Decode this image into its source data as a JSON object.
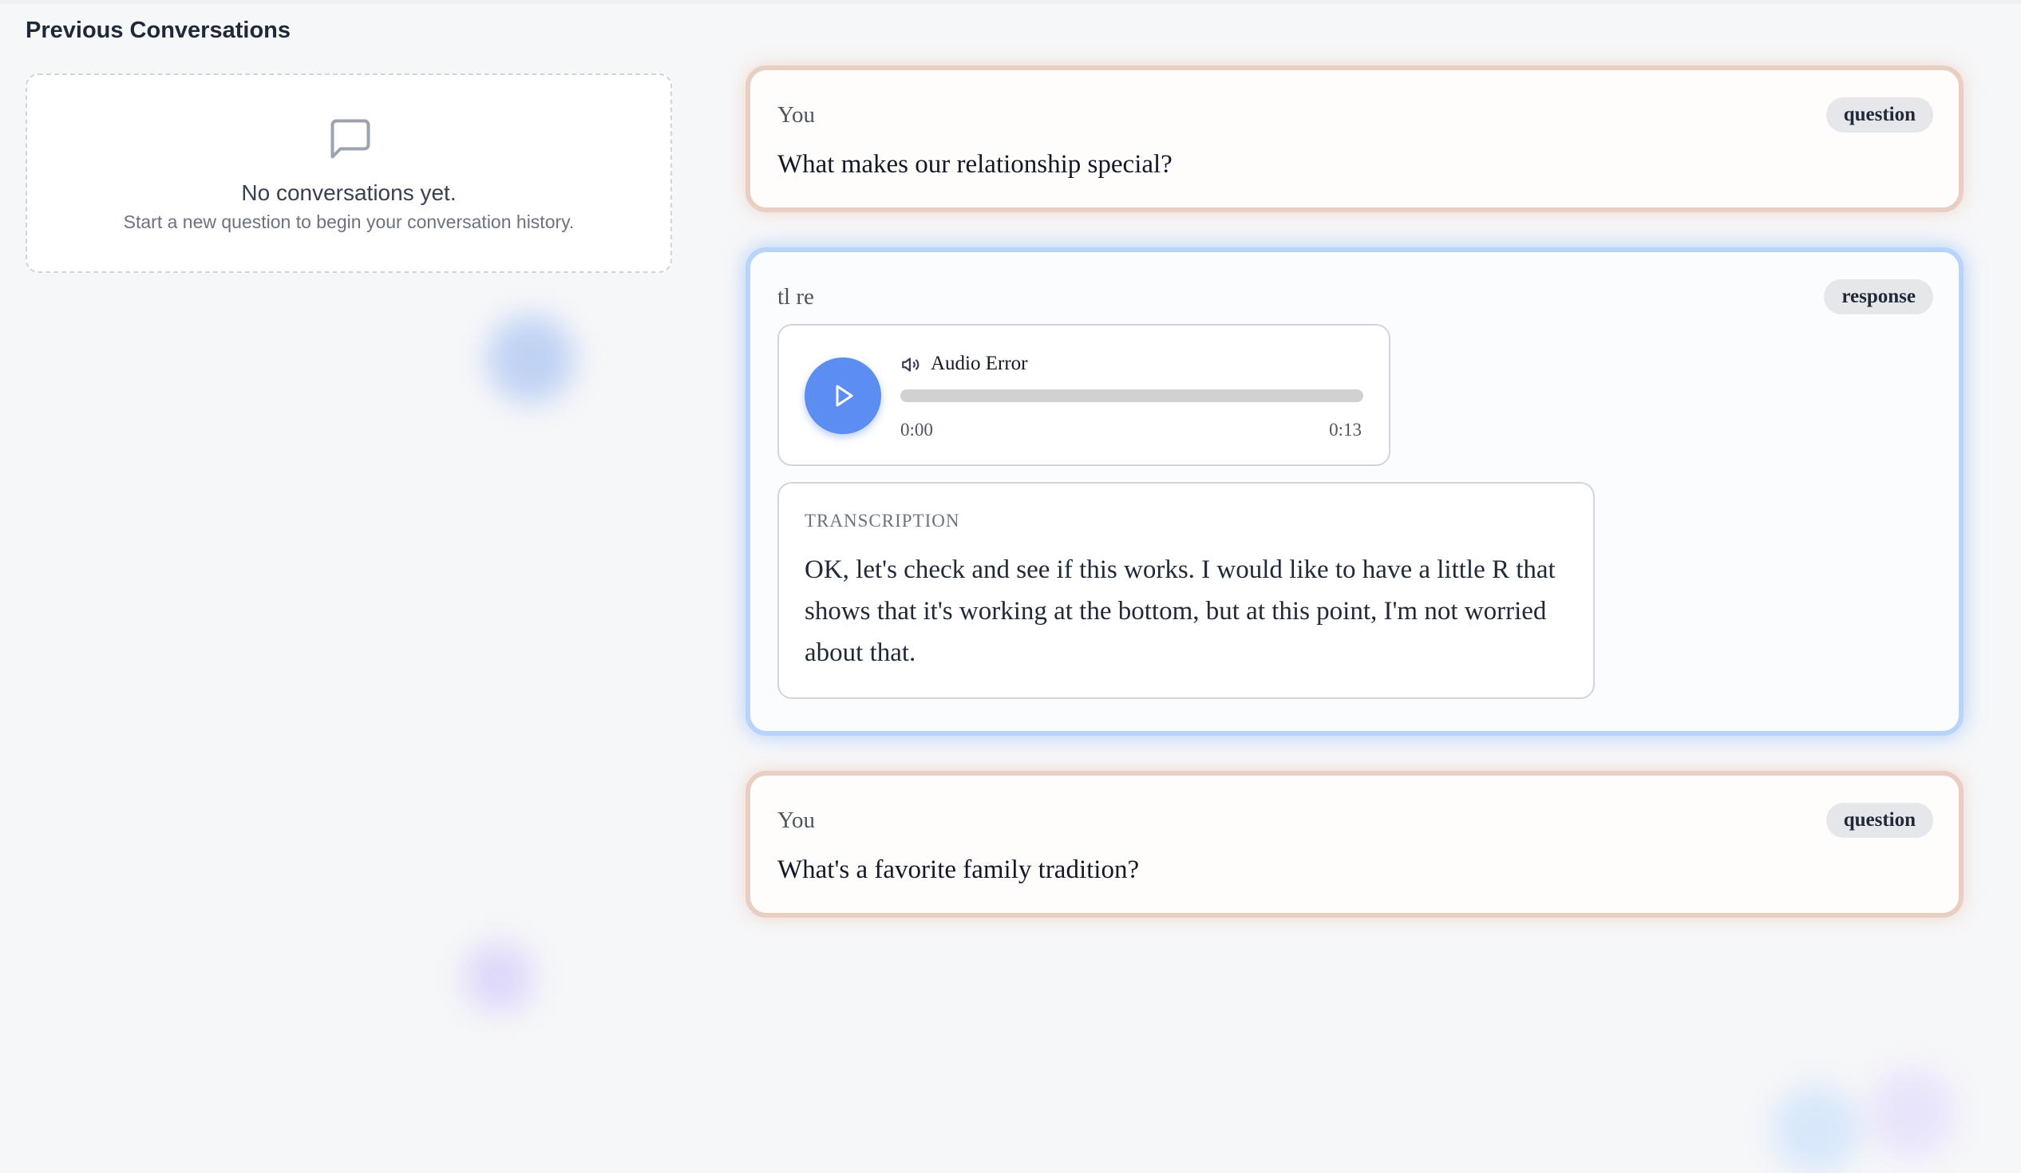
{
  "sidebar": {
    "title": "Previous Conversations",
    "empty_state": {
      "icon": "message-square-icon",
      "title": "No conversations yet.",
      "subtitle": "Start a new question to begin your conversation history."
    }
  },
  "messages": [
    {
      "who": "You",
      "badge": "question",
      "text": "What makes our relationship special?"
    },
    {
      "who": "tl re",
      "badge": "response",
      "audio": {
        "status": "Audio Error",
        "current_time": "0:00",
        "duration": "0:13",
        "progress": 0
      },
      "transcription": {
        "label": "TRANSCRIPTION",
        "text": "OK, let's check and see if this works. I would like to have a little R that shows that it's working at the bottom, but at this point, I'm not worried about that."
      }
    },
    {
      "who": "You",
      "badge": "question",
      "text": "What's a favorite family tradition?"
    }
  ],
  "colors": {
    "question_border": "#e9cfc3",
    "response_border": "#b9d4fb",
    "play_button": "#5b8ef0"
  }
}
